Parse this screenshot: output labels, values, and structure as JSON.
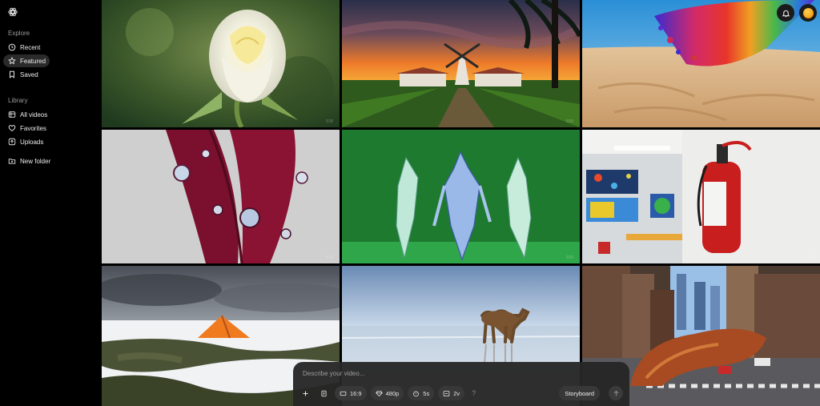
{
  "sidebar": {
    "explore_heading": "Explore",
    "explore_items": [
      {
        "label": "Recent",
        "icon": "clock-icon"
      },
      {
        "label": "Featured",
        "icon": "star-icon",
        "active": true
      },
      {
        "label": "Saved",
        "icon": "bookmark-icon"
      }
    ],
    "library_heading": "Library",
    "library_items": [
      {
        "label": "All videos",
        "icon": "video-grid-icon"
      },
      {
        "label": "Favorites",
        "icon": "heart-icon"
      },
      {
        "label": "Uploads",
        "icon": "upload-icon"
      }
    ],
    "new_folder_label": "New folder"
  },
  "gallery": {
    "tiles": [
      {
        "subject": "white rose",
        "icon": "image"
      },
      {
        "subject": "windmill at sunset",
        "icon": "image"
      },
      {
        "subject": "rainbow sand explosion",
        "icon": "image"
      },
      {
        "subject": "dew drops on red leaf",
        "icon": "image"
      },
      {
        "subject": "crystal figures on green",
        "icon": "image"
      },
      {
        "subject": "classroom fire extinguisher",
        "icon": "image"
      },
      {
        "subject": "tent in snowy field",
        "icon": "image"
      },
      {
        "subject": "camel on salt flat",
        "icon": "image"
      },
      {
        "subject": "city street sausage",
        "icon": "image"
      }
    ]
  },
  "composer": {
    "placeholder": "Describe your video...",
    "aspect_ratio": "16:9",
    "resolution": "480p",
    "duration": "5s",
    "variations": "2v",
    "help": "?",
    "storyboard_label": "Storyboard"
  },
  "colors": {
    "sidebar_bg": "#000000",
    "active_item_bg": "#2a2a2a",
    "composer_bg": "#262626",
    "avatar": "#f29d12"
  }
}
